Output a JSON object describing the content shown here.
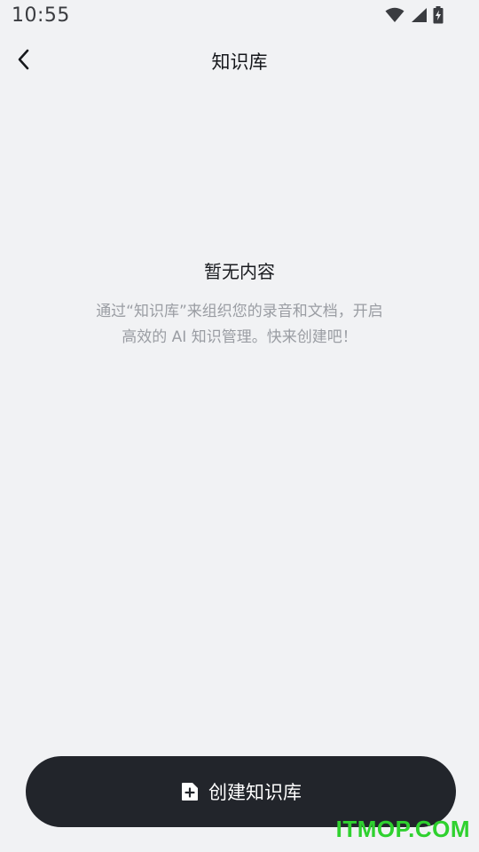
{
  "status_bar": {
    "time": "10:55",
    "icons": [
      "wifi-icon",
      "signal-icon",
      "battery-charging-icon"
    ]
  },
  "header": {
    "title": "知识库",
    "back_icon": "chevron-left-icon"
  },
  "empty_state": {
    "title": "暂无内容",
    "description": "通过“知识库”来组织您的录音和文档，开启高效的 AI 知识管理。快来创建吧！"
  },
  "create_button": {
    "label": "创建知识库",
    "icon": "add-file-icon"
  },
  "watermark": {
    "text": "ITMOP.COM",
    "color": "#2fd12f"
  },
  "colors": {
    "background": "#f1f2f4",
    "button": "#22252b",
    "muted_text": "#9a9da3"
  }
}
